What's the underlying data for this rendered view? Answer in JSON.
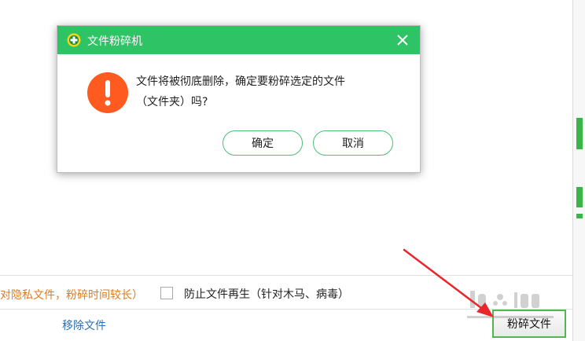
{
  "dialog": {
    "title": "文件粉碎机",
    "message_line1": "文件将被彻底删除，确定要粉碎选定的文件",
    "message_line2": "（文件夹）吗?",
    "confirm_label": "确定",
    "cancel_label": "取消",
    "icons": {
      "logo": "shield-plus-logo-icon",
      "close": "close-icon",
      "warning": "exclamation-warning-icon"
    }
  },
  "options": {
    "privacy_note": "对隐私文件，粉碎时间较长）",
    "prevent_regen_label": "防止文件再生（针对木马、病毒）",
    "prevent_regen_checked": false
  },
  "bottom": {
    "remove_link": "移除文件",
    "shred_button": "粉碎文件"
  },
  "colors": {
    "titlebar": "#2ec364",
    "warning": "#ff5a1f",
    "accent_green": "#4fb84f",
    "link_blue": "#2f6fb0",
    "note_orange": "#e07b1a",
    "annotation_red": "#e8262b"
  }
}
